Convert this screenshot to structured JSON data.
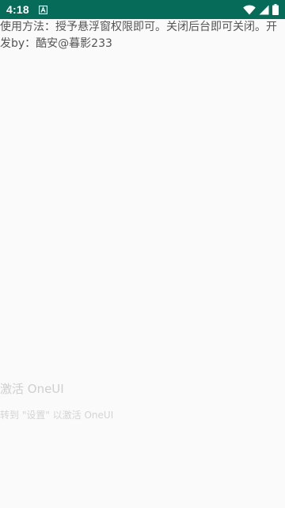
{
  "status_bar": {
    "time": "4:18",
    "background": "#066b58",
    "icons": [
      "app-notification-icon",
      "wifi-icon",
      "cell-signal-icon",
      "battery-icon"
    ]
  },
  "main": {
    "instructions": "使用方法：授予悬浮窗权限即可。关闭后台即可关闭。开发by：酷安@暮影233"
  },
  "watermark": {
    "title": "激活 OneUI",
    "subtitle": "转到 \"设置\" 以激活 OneUI"
  }
}
